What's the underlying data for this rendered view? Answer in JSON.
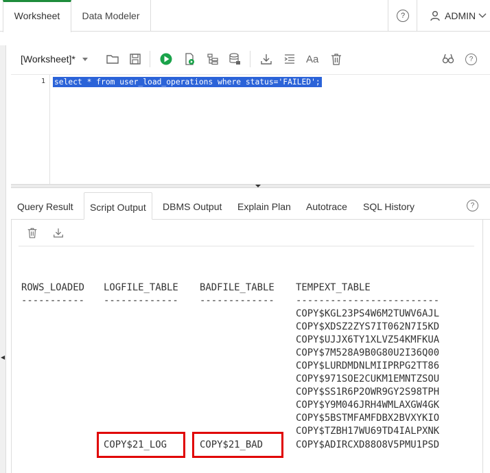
{
  "tabs": [
    {
      "label": "Worksheet",
      "active": true
    },
    {
      "label": "Data Modeler",
      "active": false
    }
  ],
  "user": {
    "name": "ADMIN",
    "help_symbol": "?"
  },
  "toolbar": {
    "worksheet_label": "[Worksheet]*",
    "icons": [
      "open-folder-icon",
      "save-icon",
      "run-statement-icon",
      "run-script-icon",
      "explain-plan-icon",
      "autotrace-icon",
      "download-icon",
      "format-icon",
      "case-icon",
      "clear-icon",
      "find-icon",
      "help-icon"
    ],
    "case_glyph": "Aa",
    "help_symbol": "?"
  },
  "editor": {
    "line_number": "1",
    "code": "select * from user_load_operations where status='FAILED';"
  },
  "output_tabs": [
    "Query Result",
    "Script Output",
    "DBMS Output",
    "Explain Plan",
    "Autotrace",
    "SQL History"
  ],
  "active_output_tab": "Script Output",
  "output_help_symbol": "?",
  "script_output": {
    "headers": [
      "ROWS_LOADED",
      "LOGFILE_TABLE",
      "BADFILE_TABLE",
      "TEMPEXT_TABLE"
    ],
    "underlines": [
      "-----------",
      "-------------",
      "-------------",
      "-------------------------"
    ],
    "tempext_tables": [
      "COPY$KGL23PS4W6M2TUWV6AJL",
      "COPY$XDSZ2ZYS7IT062N7I5KD",
      "COPY$UJJX6TY1XLVZ54KMFKUA",
      "COPY$7M528A9B0G80U2I36Q00",
      "COPY$LURDMDNLMIIPRPG2TT86",
      "COPY$971SOE2CUKM1EMNTZSOU",
      "COPY$SS1R6P2OWR9GY2S98TPH",
      "COPY$Y9M046JRH4WMLAXGW4GK",
      "COPY$5BSTMFAMFDBX2BVXYKIO",
      "COPY$TZBH17WU69TD4IALPXNK",
      "COPY$ADIRCXD88O8V5PMU1PSD"
    ],
    "logfile_table": "COPY$21_LOG",
    "badfile_table": "COPY$21_BAD",
    "highlight_color": "#e00000"
  },
  "colors": {
    "accent": "#1e8c3c",
    "selection": "#2b63d8"
  }
}
